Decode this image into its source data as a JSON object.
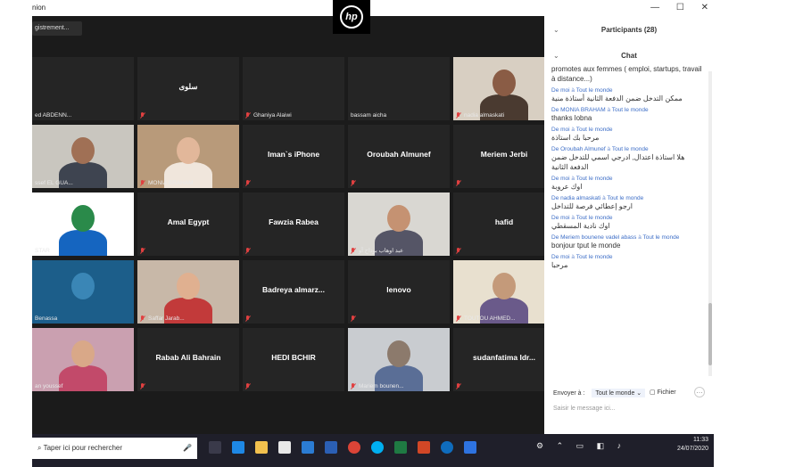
{
  "window": {
    "title": "nion",
    "record_label": "gistrement..."
  },
  "tiles": [
    {
      "name": "",
      "caption": "ed ABDENN...",
      "mic_muted": false
    },
    {
      "name": "سلوى",
      "caption": "",
      "mic_muted": true
    },
    {
      "name": "",
      "caption": "Ghaniya Alaiwi",
      "mic_muted": true
    },
    {
      "name": "",
      "caption": "bassam aicha",
      "mic_muted": false
    },
    {
      "name": "",
      "caption": "nadia almaskati",
      "mic_muted": true
    },
    {
      "name": "",
      "caption": "ssef EL GUA...",
      "mic_muted": false
    },
    {
      "name": "",
      "caption": "MONIA BRAHAM",
      "mic_muted": true
    },
    {
      "name": "Iman`s iPhone",
      "caption": "",
      "mic_muted": true
    },
    {
      "name": "Oroubah Almunef",
      "caption": "",
      "mic_muted": true
    },
    {
      "name": "Meriem Jerbi",
      "caption": "",
      "mic_muted": true
    },
    {
      "name": "",
      "caption": "STAR",
      "mic_muted": false
    },
    {
      "name": "Amal Egypt",
      "caption": "",
      "mic_muted": true
    },
    {
      "name": "Fawzia Rabea",
      "caption": "",
      "mic_muted": true
    },
    {
      "name": "",
      "caption": "عبد اوهاب بوداح آو",
      "mic_muted": true
    },
    {
      "name": "hafid",
      "caption": "",
      "mic_muted": true
    },
    {
      "name": "",
      "caption": "Benassa",
      "mic_muted": false
    },
    {
      "name": "",
      "caption": "Saffar Jarab...",
      "mic_muted": true
    },
    {
      "name": "Badreya almarz...",
      "caption": "",
      "mic_muted": true
    },
    {
      "name": "lenovo",
      "caption": "",
      "mic_muted": true
    },
    {
      "name": "",
      "caption": "TOUTOU AHMED...",
      "mic_muted": true
    },
    {
      "name": "",
      "caption": "an youssef",
      "mic_muted": false
    },
    {
      "name": "Rabab Ali Bahrain",
      "caption": "",
      "mic_muted": true
    },
    {
      "name": "HEDI BCHIR",
      "caption": "",
      "mic_muted": true
    },
    {
      "name": "",
      "caption": "Mariem bounen...",
      "mic_muted": true
    },
    {
      "name": "sudanfatima Idr...",
      "caption": "",
      "mic_muted": true
    }
  ],
  "panel": {
    "participants_label": "Participants (28)",
    "chat_label": "Chat",
    "window_controls": [
      "—",
      "☐",
      "✕"
    ]
  },
  "chat": [
    {
      "from": "",
      "to": "",
      "text": "promotes aux femmes ( emploi, startups, travail à distance...)",
      "rtl": false
    },
    {
      "from": "De moi",
      "to": "Tout le monde",
      "text": "ممكن التدخل ضمن الدفعة الثانية أستاذة منية",
      "rtl": true
    },
    {
      "from": "De MONIA BRAHAM",
      "to": "Tout le monde",
      "text": "thanks lobna",
      "rtl": false
    },
    {
      "from": "De moi",
      "to": "Tout le monde",
      "text": "مرحبا بك استاذة",
      "rtl": true
    },
    {
      "from": "De Oroubah Almunef",
      "to": "Tout le monde",
      "text": "هلا استاذة اعتدال, ادرجي اسمي للتدخل ضمن الدفعة الثانية",
      "rtl": true
    },
    {
      "from": "De moi",
      "to": "Tout le monde",
      "text": "اوك عروبة",
      "rtl": true
    },
    {
      "from": "De nadia almaskati",
      "to": "Tout le monde",
      "text": "ارجو إعطائي  فرصة للتداخل",
      "rtl": true
    },
    {
      "from": "De moi",
      "to": "Tout le monde",
      "text": "اوك نادية المسقطي",
      "rtl": true
    },
    {
      "from": "De Meriem bounene vadel abass",
      "to": "Tout le monde",
      "text": "bonjour tput le monde",
      "rtl": false
    },
    {
      "from": "De moi",
      "to": "Tout le monde",
      "text": "مرحبا",
      "rtl": true
    }
  ],
  "chat_footer": {
    "send_to_label": "Envoyer à :",
    "send_to_value": "Tout le monde",
    "file_label": "Fichier",
    "message_placeholder": "Saisir le message ici..."
  },
  "taskbar": {
    "search_placeholder": "Taper ici pour rechercher",
    "time": "11:33",
    "date": "24/07/2020"
  },
  "colors": {
    "accent": "#3d6ec7",
    "muted_mic": "#e04040",
    "tile_bg": "#252525"
  }
}
